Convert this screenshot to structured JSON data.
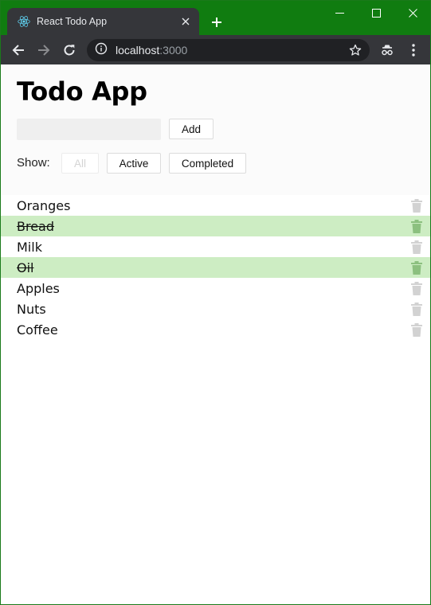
{
  "browser": {
    "tab_title": "React Todo App",
    "url_host": "localhost",
    "url_port": ":3000",
    "colors": {
      "frame": "#107c10",
      "toolbar": "#35363a",
      "omnibox": "#202124"
    }
  },
  "app": {
    "title": "Todo App",
    "input_value": "",
    "add_label": "Add",
    "show_label": "Show:",
    "filters": [
      "All",
      "Active",
      "Completed"
    ],
    "active_filter": "All"
  },
  "todos": [
    {
      "text": "Oranges",
      "completed": false
    },
    {
      "text": "Bread",
      "completed": true
    },
    {
      "text": "Milk",
      "completed": false
    },
    {
      "text": "Oil",
      "completed": true
    },
    {
      "text": "Apples",
      "completed": false
    },
    {
      "text": "Nuts",
      "completed": false
    },
    {
      "text": "Coffee",
      "completed": false
    }
  ],
  "colors": {
    "completed_bg": "#cdedc3",
    "trash_idle": "#d2d2d2",
    "trash_done": "#8cc07f"
  }
}
